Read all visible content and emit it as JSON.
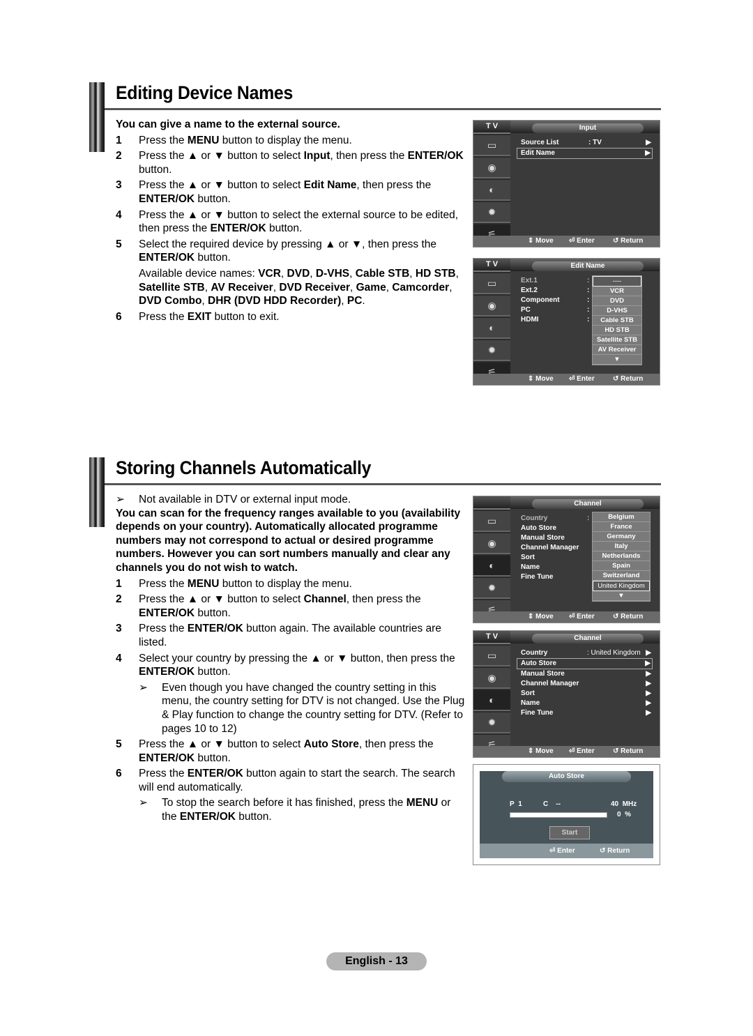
{
  "section1": {
    "title": "Editing Device Names",
    "lead": "You can give a name to the external source.",
    "steps": [
      {
        "num": "1",
        "text": "Press the MENU button to display the menu."
      },
      {
        "num": "2",
        "text": "Press the ▲ or ▼ button to select Input, then press the ENTER/OK button."
      },
      {
        "num": "3",
        "text": "Press the ▲ or ▼ button to select Edit Name, then press the ENTER/OK button."
      },
      {
        "num": "4",
        "text": "Press the ▲ or ▼ button to select the external source to be edited, then press the ENTER/OK button."
      },
      {
        "num": "5",
        "text": "Select the required device by pressing ▲ or ▼, then press the ENTER/OK button."
      },
      {
        "num": "6",
        "text": "Press the EXIT button to exit."
      }
    ],
    "available_names": "Available device names: VCR, DVD, D-VHS, Cable STB, HD STB, Satellite STB, AV Receiver, DVD Receiver, Game, Camcorder, DVD Combo, DHR (DVD HDD Recorder), PC."
  },
  "section2": {
    "title": "Storing Channels Automatically",
    "note": "Not available in DTV or external input mode.",
    "lead": "You can scan for the frequency ranges available to you (availability depends on your country). Automatically allocated programme numbers may not correspond to actual or desired programme numbers. However you can sort numbers manually and clear any channels you do not wish to watch.",
    "steps": [
      {
        "num": "1",
        "text": "Press the MENU button to display the menu."
      },
      {
        "num": "2",
        "text": "Press the ▲ or ▼ button to select Channel, then press the ENTER/OK button."
      },
      {
        "num": "3",
        "text": "Press the ENTER/OK button again. The available countries are listed."
      },
      {
        "num": "4",
        "text": "Select your country by pressing the ▲ or ▼ button, then press the ENTER/OK button."
      },
      {
        "num": "5",
        "text": "Press the ▲ or ▼ button to select Auto Store, then press the ENTER/OK button."
      },
      {
        "num": "6",
        "text": "Press the ENTER/OK button again to start the search. The search will end automatically."
      }
    ],
    "step4_note": "Even though you have changed the country setting in this menu, the country setting for DTV is not changed. Use the Plug & Play function to change the country setting for DTV. (Refer to pages 10 to 12)",
    "step6_note": "To stop the search before it has finished, press the MENU or the ENTER/OK button."
  },
  "menus": {
    "tv_label": "T V",
    "footer": {
      "move": "Move",
      "enter": "Enter",
      "return": "Return"
    },
    "input": {
      "title": "Input",
      "rows": [
        {
          "label": "Source List",
          "value": ": TV"
        },
        {
          "label": "Edit Name",
          "value": ""
        }
      ]
    },
    "edit_name": {
      "title": "Edit Name",
      "rows": [
        "Ext.1",
        "Ext.2",
        "Component",
        "PC",
        "HDMI"
      ],
      "options": [
        "----",
        "VCR",
        "DVD",
        "D-VHS",
        "Cable STB",
        "HD STB",
        "Satellite STB",
        "AV Receiver"
      ]
    },
    "channel_list": {
      "title": "Channel",
      "rows": [
        "Country",
        "Auto Store",
        "Manual Store",
        "Channel Manager",
        "Sort",
        "Name",
        "Fine Tune"
      ],
      "options": [
        "Belgium",
        "France",
        "Germany",
        "Italy",
        "Netherlands",
        "Spain",
        "Switzerland",
        "United Kingdom"
      ]
    },
    "channel": {
      "title": "Channel",
      "country_value": ": United Kingdom",
      "rows": [
        "Country",
        "Auto Store",
        "Manual Store",
        "Channel Manager",
        "Sort",
        "Name",
        "Fine Tune"
      ]
    },
    "auto_store": {
      "title": "Auto Store",
      "p_label": "P",
      "p_value": "1",
      "c_label": "C",
      "c_value": "--",
      "freq": "40",
      "freq_unit": "MHz",
      "progress_percent": 0,
      "progress_text": "0",
      "progress_unit": "%",
      "start": "Start"
    }
  },
  "page": {
    "label": "English - 13"
  }
}
